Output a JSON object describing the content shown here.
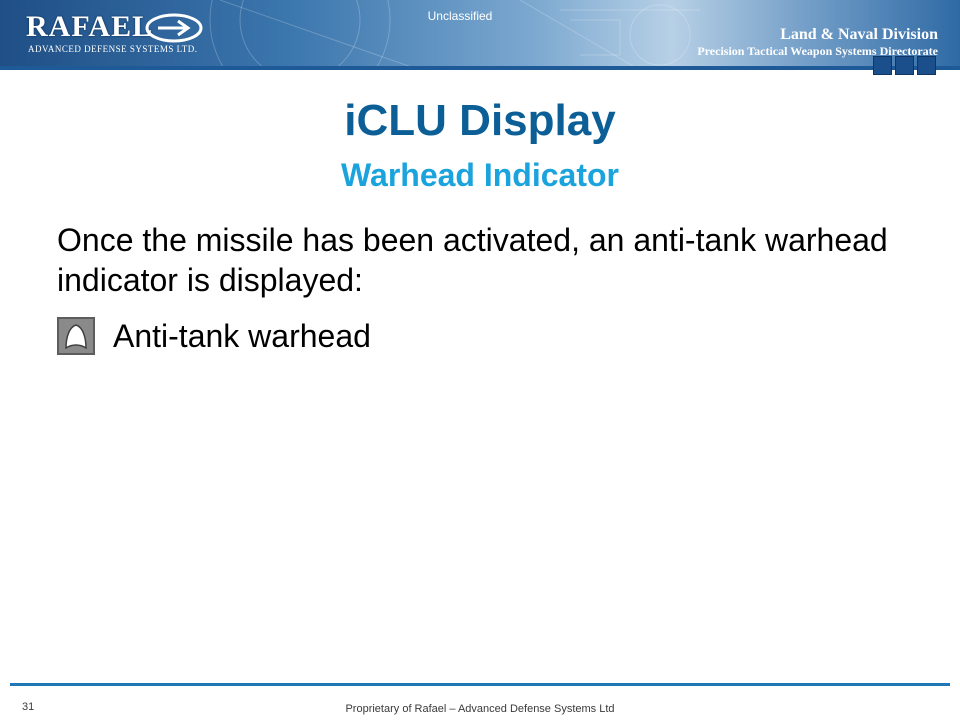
{
  "header": {
    "logo_text": "RAFAEL",
    "logo_subtext": "ADVANCED DEFENSE SYSTEMS LTD.",
    "classification": "Unclassified",
    "division_title": "Land & Naval Division",
    "division_subtitle": "Precision Tactical Weapon Systems Directorate"
  },
  "slide": {
    "title": "iCLU Display",
    "subtitle": "Warhead Indicator",
    "body": "Once the missile has been activated, an anti-tank warhead indicator is displayed:",
    "bullets": [
      {
        "icon": "anti-tank-warhead-icon",
        "label": "Anti-tank warhead"
      }
    ]
  },
  "footer": {
    "page_number": "31",
    "text": "Proprietary of Rafael – Advanced Defense Systems Ltd"
  },
  "colors": {
    "title": "#0c5f96",
    "subtitle": "#1aa3dc",
    "footer_line": "#1e78b6"
  }
}
